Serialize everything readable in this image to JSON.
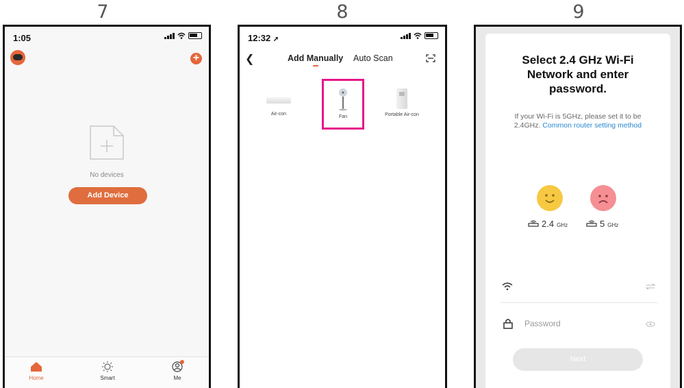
{
  "steps": [
    "7",
    "8",
    "9"
  ],
  "screen7": {
    "status_time": "1:05",
    "empty_text": "No devices",
    "add_device_label": "Add Device",
    "tabs": [
      {
        "label": "Home",
        "icon": "home-icon",
        "active": true
      },
      {
        "label": "Smart",
        "icon": "sun-icon",
        "active": false
      },
      {
        "label": "Me",
        "icon": "profile-icon",
        "active": false
      }
    ],
    "accent_color": "#e5663a"
  },
  "screen8": {
    "status_time": "12:32",
    "tab_manual": "Add Manually",
    "tab_scan": "Auto Scan",
    "devices": [
      {
        "label": "Air-con",
        "icon": "aircon-icon"
      },
      {
        "label": "Fan",
        "icon": "fan-icon",
        "highlighted": true
      },
      {
        "label": "Portable Air-con",
        "icon": "portable-aircon-icon"
      }
    ],
    "highlight_color": "#e6168a"
  },
  "screen9": {
    "title": "Select 2.4 GHz Wi-Fi Network and enter password.",
    "subtitle_plain": "If your Wi-Fi is 5GHz, please set it to be 2.4GHz.",
    "subtitle_link": "Common router setting method",
    "band_ok": "2.4",
    "band_ok_unit": "GHz",
    "band_bad": "5",
    "band_bad_unit": "GHz",
    "password_placeholder": "Password",
    "next_label": "Next",
    "link_color": "#2a87d0"
  }
}
